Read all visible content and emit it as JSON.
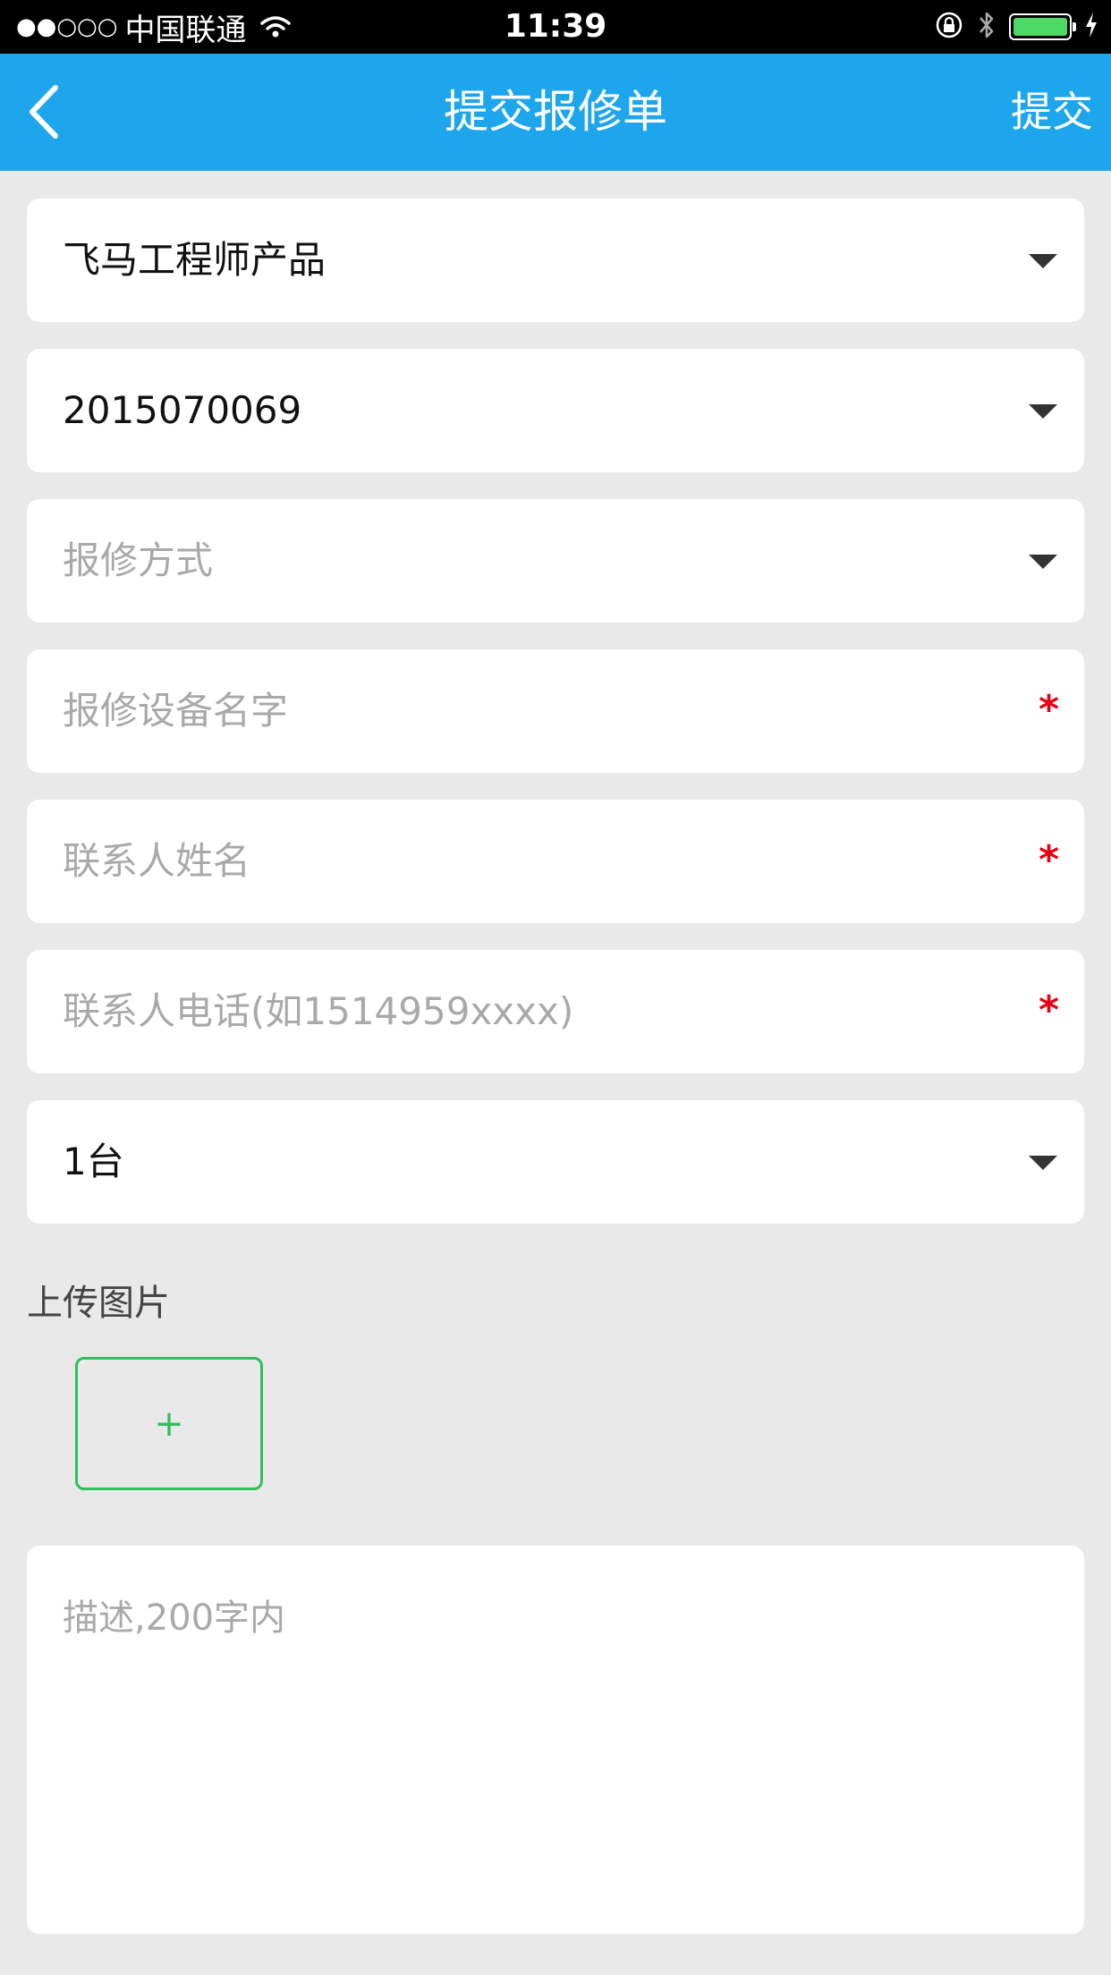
{
  "status_bar": {
    "signal": "●●○○○",
    "carrier": "中国联通",
    "time": "11:39",
    "icons": [
      "wifi-icon",
      "orientation-lock-icon",
      "bluetooth-icon",
      "battery-icon",
      "charging-icon"
    ]
  },
  "nav": {
    "back_icon": "chevron-left-icon",
    "title": "提交报修单",
    "submit_label": "提交",
    "color": "#1ea6ec"
  },
  "form": {
    "product": {
      "value": "飞马工程师产品"
    },
    "serial": {
      "value": "2015070069"
    },
    "repair_method": {
      "placeholder": "报修方式"
    },
    "device_name": {
      "placeholder": "报修设备名字",
      "required_mark": "*"
    },
    "contact_name": {
      "placeholder": "联系人姓名",
      "required_mark": "*"
    },
    "contact_phone": {
      "placeholder": "联系人电话(如1514959xxxx)",
      "required_mark": "*"
    },
    "quantity": {
      "value": "1台"
    }
  },
  "upload": {
    "label": "上传图片",
    "add_label": "+"
  },
  "description": {
    "placeholder": "描述,200字内"
  },
  "colors": {
    "required": "#e60012",
    "upload_accent": "#2fbf5c",
    "background": "#e9e9e9"
  }
}
